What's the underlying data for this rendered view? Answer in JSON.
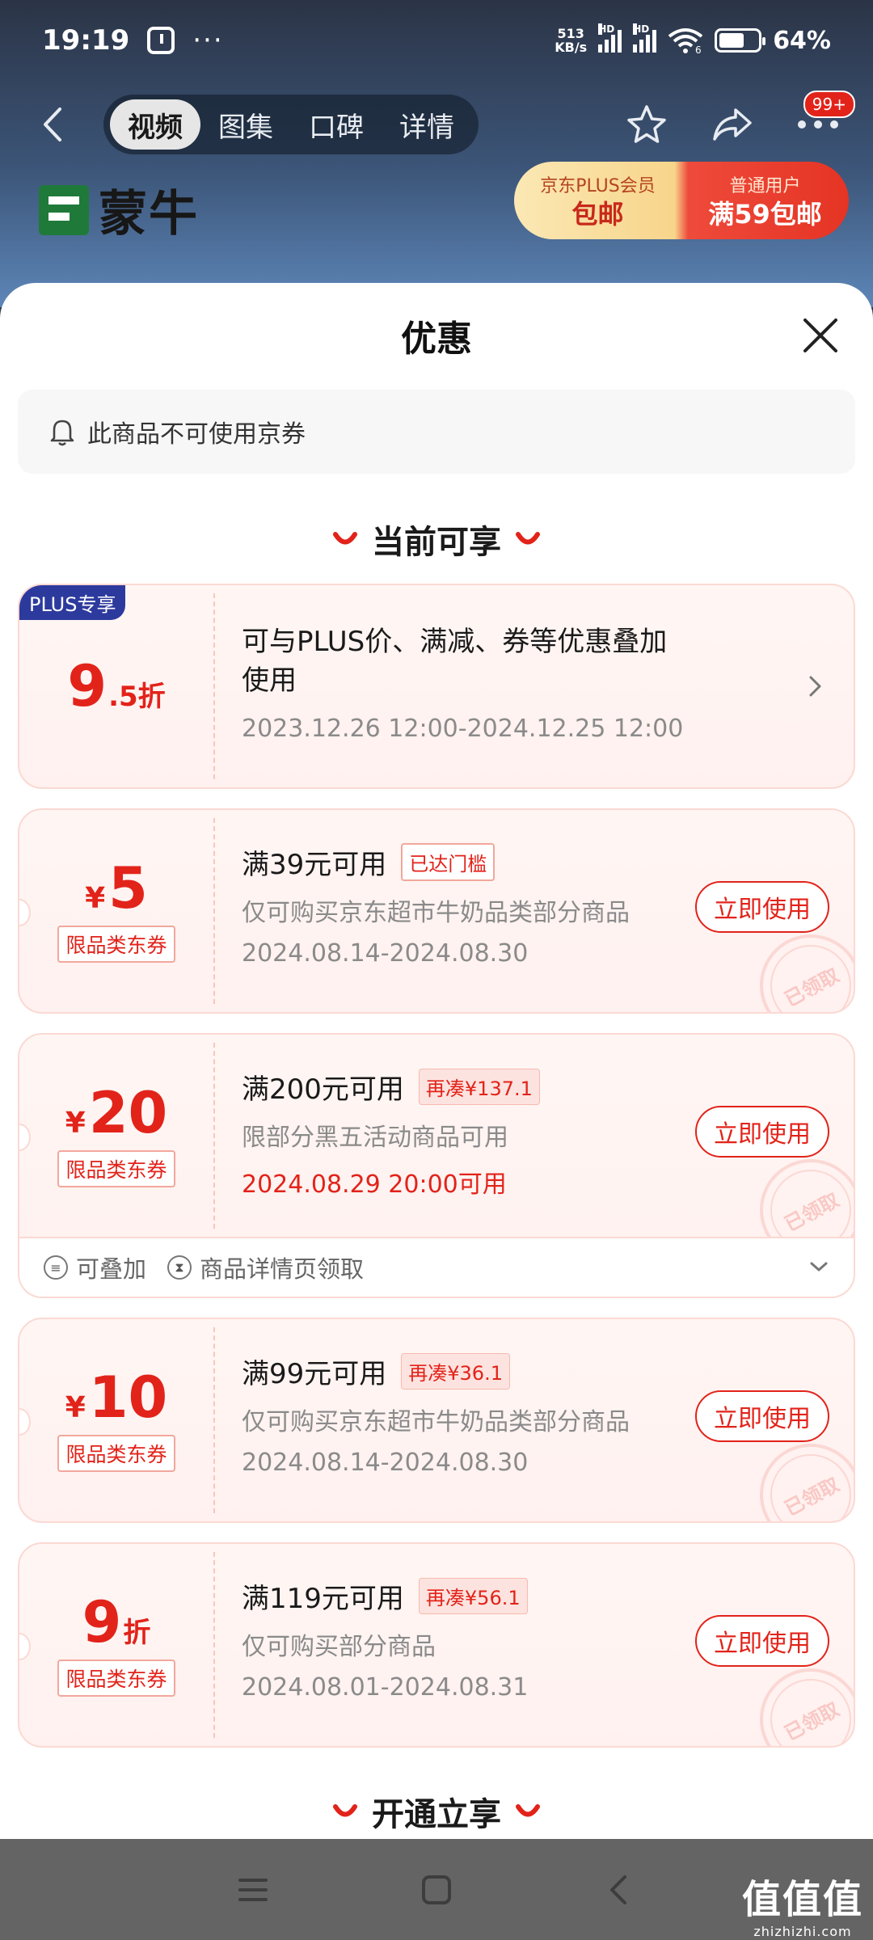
{
  "status": {
    "time": "19:19",
    "dots": "···",
    "net_speed_value": "513",
    "net_speed_unit": "KB/s",
    "hd1": "HD",
    "hd2": "HD",
    "wifi_sub": "6",
    "battery_percent": "64%",
    "battery_level": 0.64
  },
  "nav": {
    "tabs": [
      {
        "label": "视频",
        "active": true
      },
      {
        "label": "图集",
        "active": false
      },
      {
        "label": "口碑",
        "active": false
      },
      {
        "label": "详情",
        "active": false
      }
    ],
    "badge": "99+"
  },
  "product_banner": {
    "brand_name": "蒙牛",
    "plus_label": "京东PLUS会员",
    "plus_value": "包邮",
    "normal_label": "普通用户",
    "normal_value": "满59包邮"
  },
  "sheet": {
    "title": "优惠",
    "notice": "此商品不可使用京券",
    "section_current": "当前可享",
    "section_open": "开通立享"
  },
  "plus_card": {
    "tag": "PLUS专享",
    "discount_main": "9",
    "discount_sub": ".5折",
    "line1": "可与PLUS价、满减、券等优惠叠加",
    "line2": "使用",
    "dates": "2023.12.26 12:00-2024.12.25 12:00"
  },
  "coupons": [
    {
      "currency": "¥",
      "amount": "5",
      "suffix": "",
      "type": "限品类东券",
      "condition": "满39元可用",
      "pill": "已达门槛",
      "desc": "仅可购买京东超市牛奶品类部分商品",
      "dates": "2024.08.14-2024.08.30",
      "button": "立即使用",
      "stamp": "已领取"
    },
    {
      "currency": "¥",
      "amount": "20",
      "suffix": "",
      "type": "限品类东券",
      "condition": "满200元可用",
      "pill": "再凑¥137.1",
      "desc": "限部分黑五活动商品可用",
      "dates": "2024.08.29 20:00可用",
      "button": "立即使用",
      "stamp": "已领取",
      "footer_stack": "可叠加",
      "footer_source": "商品详情页领取"
    },
    {
      "currency": "¥",
      "amount": "10",
      "suffix": "",
      "type": "限品类东券",
      "condition": "满99元可用",
      "pill": "再凑¥36.1",
      "desc": "仅可购买京东超市牛奶品类部分商品",
      "dates": "2024.08.14-2024.08.30",
      "button": "立即使用",
      "stamp": "已领取"
    },
    {
      "currency": "",
      "amount": "9",
      "suffix": "折",
      "type": "限品类东券",
      "condition": "满119元可用",
      "pill": "再凑¥56.1",
      "desc": "仅可购买部分商品",
      "dates": "2024.08.01-2024.08.31",
      "button": "立即使用",
      "stamp": "已领取"
    }
  ],
  "watermark": {
    "big": "值值值",
    "small": "zhizhizhi.com"
  },
  "colors": {
    "accent_red": "#e2231a",
    "plus_blue": "#2d3a9d",
    "card_bg": "#fff4f2"
  },
  "icons": [
    "back-icon",
    "star-icon",
    "share-icon",
    "more-icon",
    "close-icon",
    "bell-icon",
    "chevron-right-icon",
    "chevron-down-icon",
    "menu-icon",
    "home-icon",
    "nav-back-icon"
  ]
}
